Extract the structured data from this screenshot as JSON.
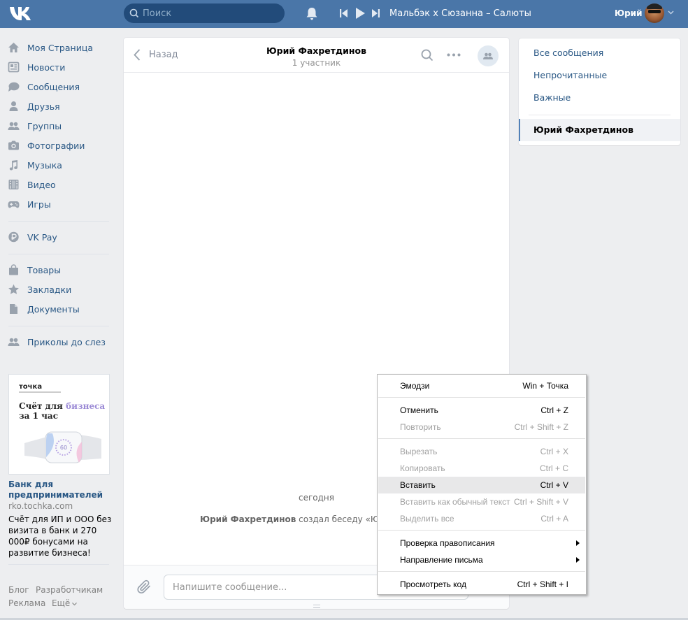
{
  "header": {
    "search_placeholder": "Поиск",
    "track_title": "Мальбэк x Сюзанна – Салюты",
    "user_name": "Юрий"
  },
  "nav": {
    "items": [
      {
        "label": "Моя Страница",
        "icon": "home-icon"
      },
      {
        "label": "Новости",
        "icon": "news-icon"
      },
      {
        "label": "Сообщения",
        "icon": "messages-icon"
      },
      {
        "label": "Друзья",
        "icon": "friend-icon"
      },
      {
        "label": "Группы",
        "icon": "groups-icon"
      },
      {
        "label": "Фотографии",
        "icon": "camera-icon"
      },
      {
        "label": "Музыка",
        "icon": "music-note-icon"
      },
      {
        "label": "Видео",
        "icon": "film-icon"
      },
      {
        "label": "Игры",
        "icon": "gamepad-icon"
      }
    ],
    "vkpay": "VK Pay",
    "goods": "Товары",
    "bookmarks": "Закладки",
    "documents": "Документы",
    "group": "Приколы до слез"
  },
  "ad": {
    "brand": "точка",
    "headline_1": "Счёт для",
    "headline_accent": "бизнеса",
    "headline_2": "за 1 час",
    "badge": "60",
    "title": "Банк для предпринимателей",
    "domain": "rko.tochka.com",
    "text": "Счёт для ИП и ООО без визита в банк и 270 000₽ бонусами на развитие бизнеса!"
  },
  "footer": {
    "blog": "Блог",
    "developers": "Разработчикам",
    "ads": "Реклама",
    "more": "Ещё"
  },
  "chat": {
    "back": "Назад",
    "title": "Юрий Фахретдинов",
    "subtitle": "1 участник",
    "day": "сегодня",
    "service_author": "Юрий Фахретдинов",
    "service_text": " создал беседу «Юрий Ф",
    "input_placeholder": "Напишите сообщение..."
  },
  "right_menu": {
    "all": "Все сообщения",
    "unread": "Непрочитанные",
    "important": "Важные",
    "active": "Юрий Фахретдинов"
  },
  "context_menu": {
    "emoji": {
      "label": "Эмодзи",
      "shortcut": "Win + Точка"
    },
    "undo": {
      "label": "Отменить",
      "shortcut": "Ctrl + Z"
    },
    "redo": {
      "label": "Повторить",
      "shortcut": "Ctrl + Shift + Z"
    },
    "cut": {
      "label": "Вырезать",
      "shortcut": "Ctrl + X"
    },
    "copy": {
      "label": "Копировать",
      "shortcut": "Ctrl + C"
    },
    "paste": {
      "label": "Вставить",
      "shortcut": "Ctrl + V"
    },
    "paste_plain": {
      "label": "Вставить как обычный текст",
      "shortcut": "Ctrl + Shift + V"
    },
    "select_all": {
      "label": "Выделить все",
      "shortcut": "Ctrl + A"
    },
    "spellcheck": {
      "label": "Проверка правописания"
    },
    "writing_direction": {
      "label": "Направление письма"
    },
    "inspect": {
      "label": "Просмотреть код",
      "shortcut": "Ctrl + Shift + I"
    }
  },
  "colors": {
    "header_bg": "#4a76a8",
    "link": "#2a5885",
    "page_bg": "#edeef0"
  }
}
